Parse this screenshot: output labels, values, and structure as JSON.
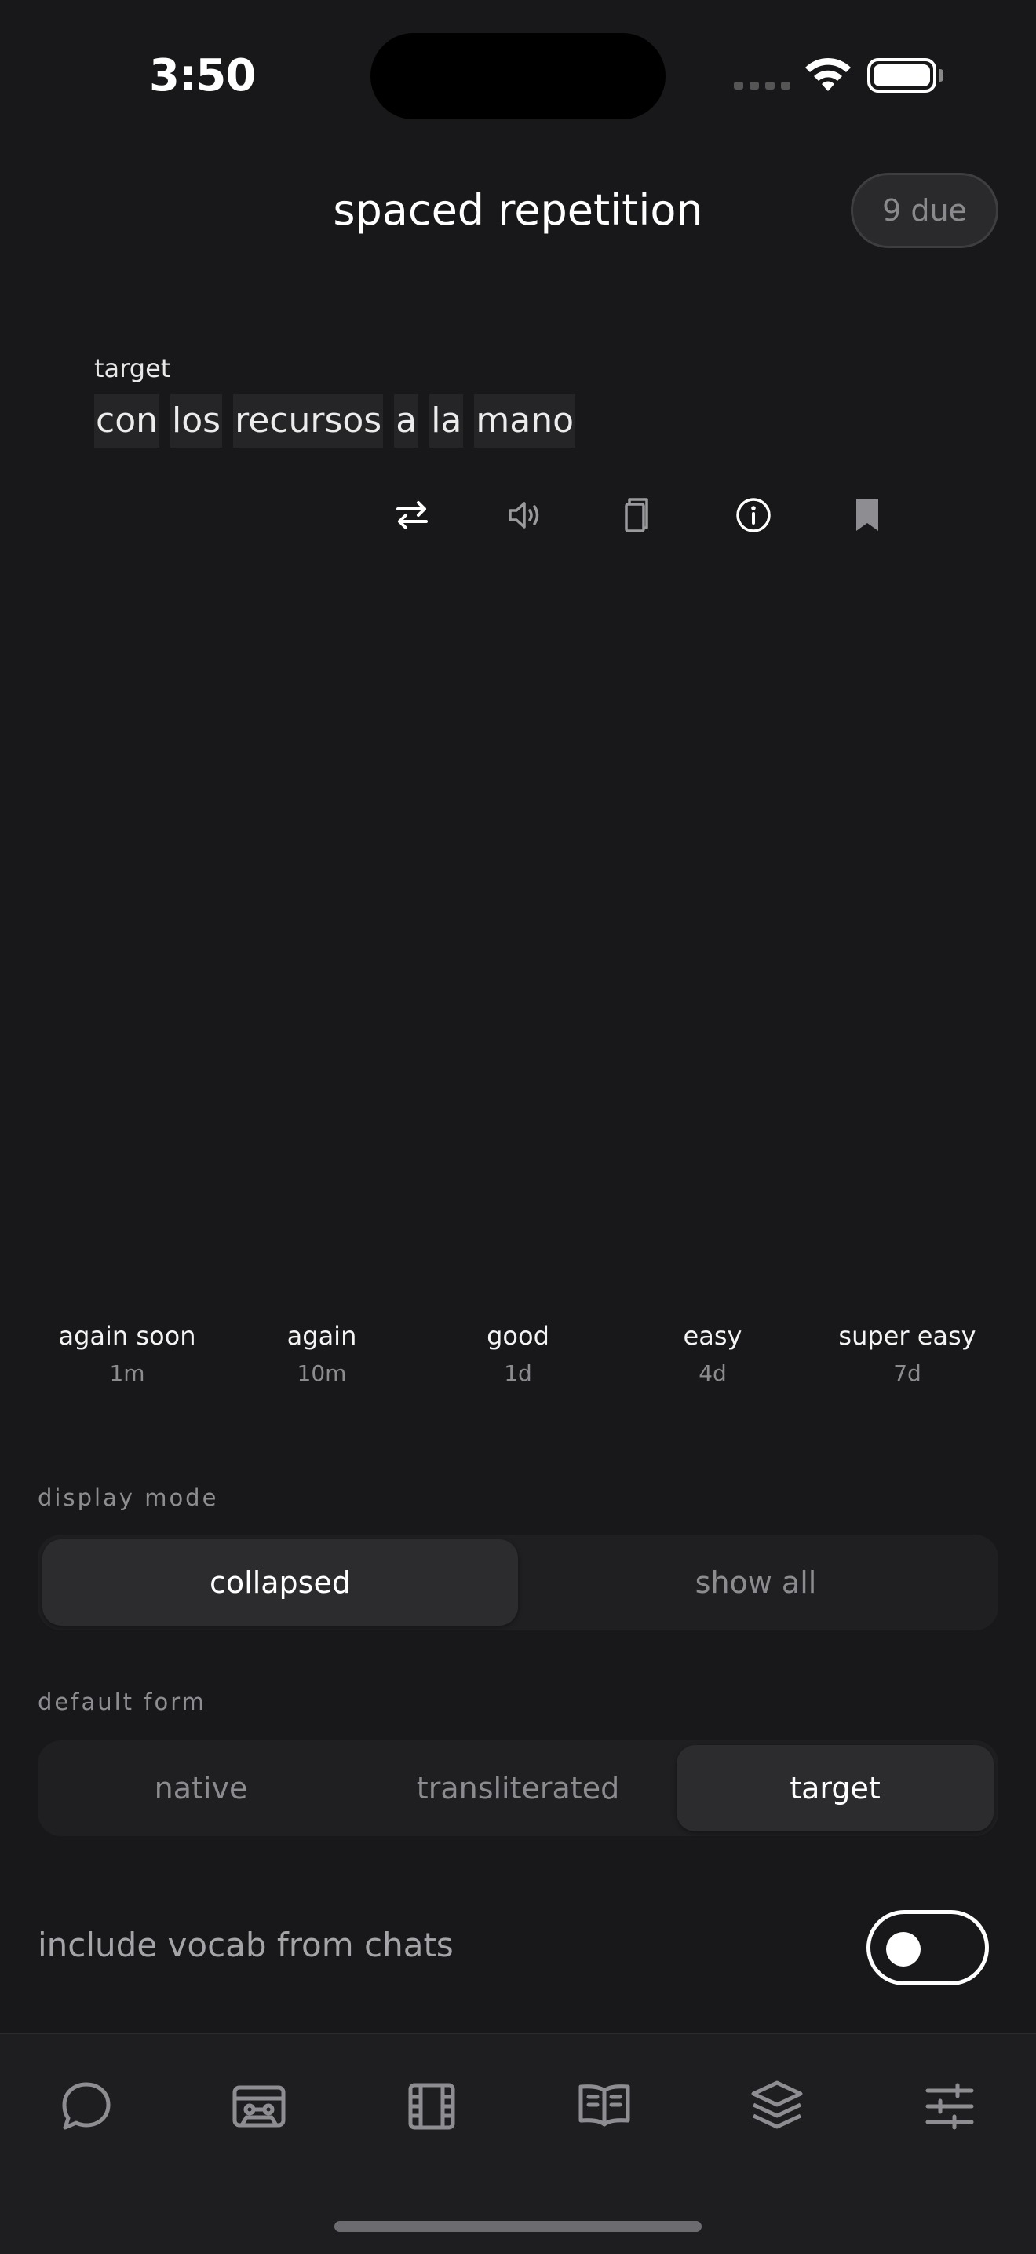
{
  "status_bar": {
    "time": "3:50"
  },
  "header": {
    "title": "spaced repetition",
    "due_badge": "9 due"
  },
  "card": {
    "form_label": "target",
    "words": [
      "con",
      "los",
      "recursos",
      "a",
      "la",
      "mano"
    ],
    "actions": [
      "swap-icon",
      "speaker-icon",
      "copy-icon",
      "info-icon",
      "bookmark-icon"
    ]
  },
  "ratings": [
    {
      "label": "again soon",
      "interval": "1m"
    },
    {
      "label": "again",
      "interval": "10m"
    },
    {
      "label": "good",
      "interval": "1d"
    },
    {
      "label": "easy",
      "interval": "4d"
    },
    {
      "label": "super easy",
      "interval": "7d"
    }
  ],
  "display_mode": {
    "label": "display mode",
    "options": [
      "collapsed",
      "show all"
    ],
    "selected": "collapsed"
  },
  "default_form": {
    "label": "default form",
    "options": [
      "native",
      "transliterated",
      "target"
    ],
    "selected": "target"
  },
  "include_vocab": {
    "label": "include vocab from chats",
    "enabled": false
  },
  "tab_bar": [
    "chat-icon",
    "cassette-icon",
    "film-icon",
    "book-icon",
    "layers-icon",
    "sliders-icon"
  ],
  "colors": {
    "background": "#18181a",
    "surface": "#1f1f21",
    "active_segment": "#2c2c2e",
    "muted_text": "#8c8c90"
  }
}
